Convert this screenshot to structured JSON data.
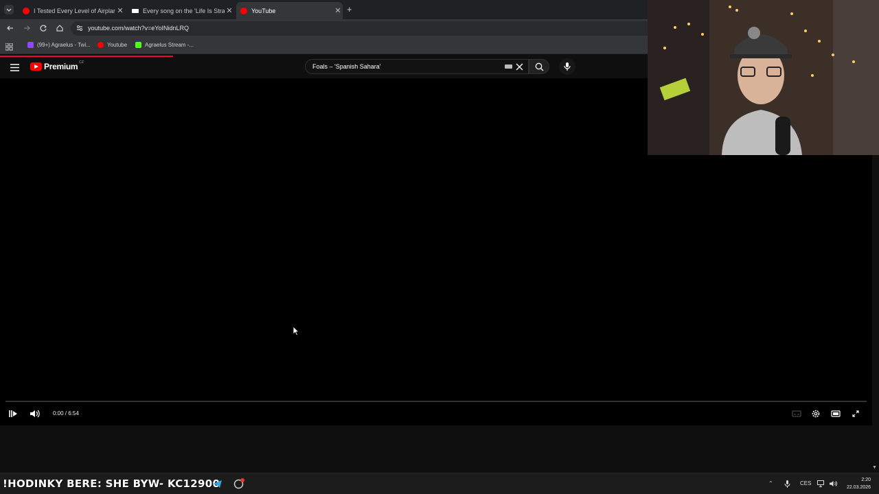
{
  "browser": {
    "tabs": [
      {
        "title": "I Tested Every Level of Airplane",
        "favicon_color": "#ff0000",
        "active": false
      },
      {
        "title": "Every song on the 'Life Is Strange'",
        "favicon_color": "#ffffff",
        "active": false
      },
      {
        "title": "YouTube",
        "favicon_color": "#ff0000",
        "active": true
      }
    ],
    "new_tab_symbol": "+",
    "url": "youtube.com/watch?v=eYoINidnLRQ",
    "bookmarks": [
      {
        "label": "(99+) Agraelus - Twi...",
        "icon_color": "#9146ff"
      },
      {
        "label": "Youtube",
        "icon_color": "#ff0000"
      },
      {
        "label": "Agraelus Stream -...",
        "icon_color": "#53fc18"
      }
    ]
  },
  "youtube": {
    "logo_text": "Premium",
    "country_code": "CZ",
    "search_query": "Foals – 'Spanish Sahara'",
    "accent_color": "#ff0000"
  },
  "player": {
    "time": "0:00 / 6:54",
    "progress": 0
  },
  "taskbar": {
    "ticker": "!HODINKY BERE: SHE  BYW- KC12900",
    "language": "CES",
    "time": "2:20",
    "date": "22.03.2026"
  }
}
